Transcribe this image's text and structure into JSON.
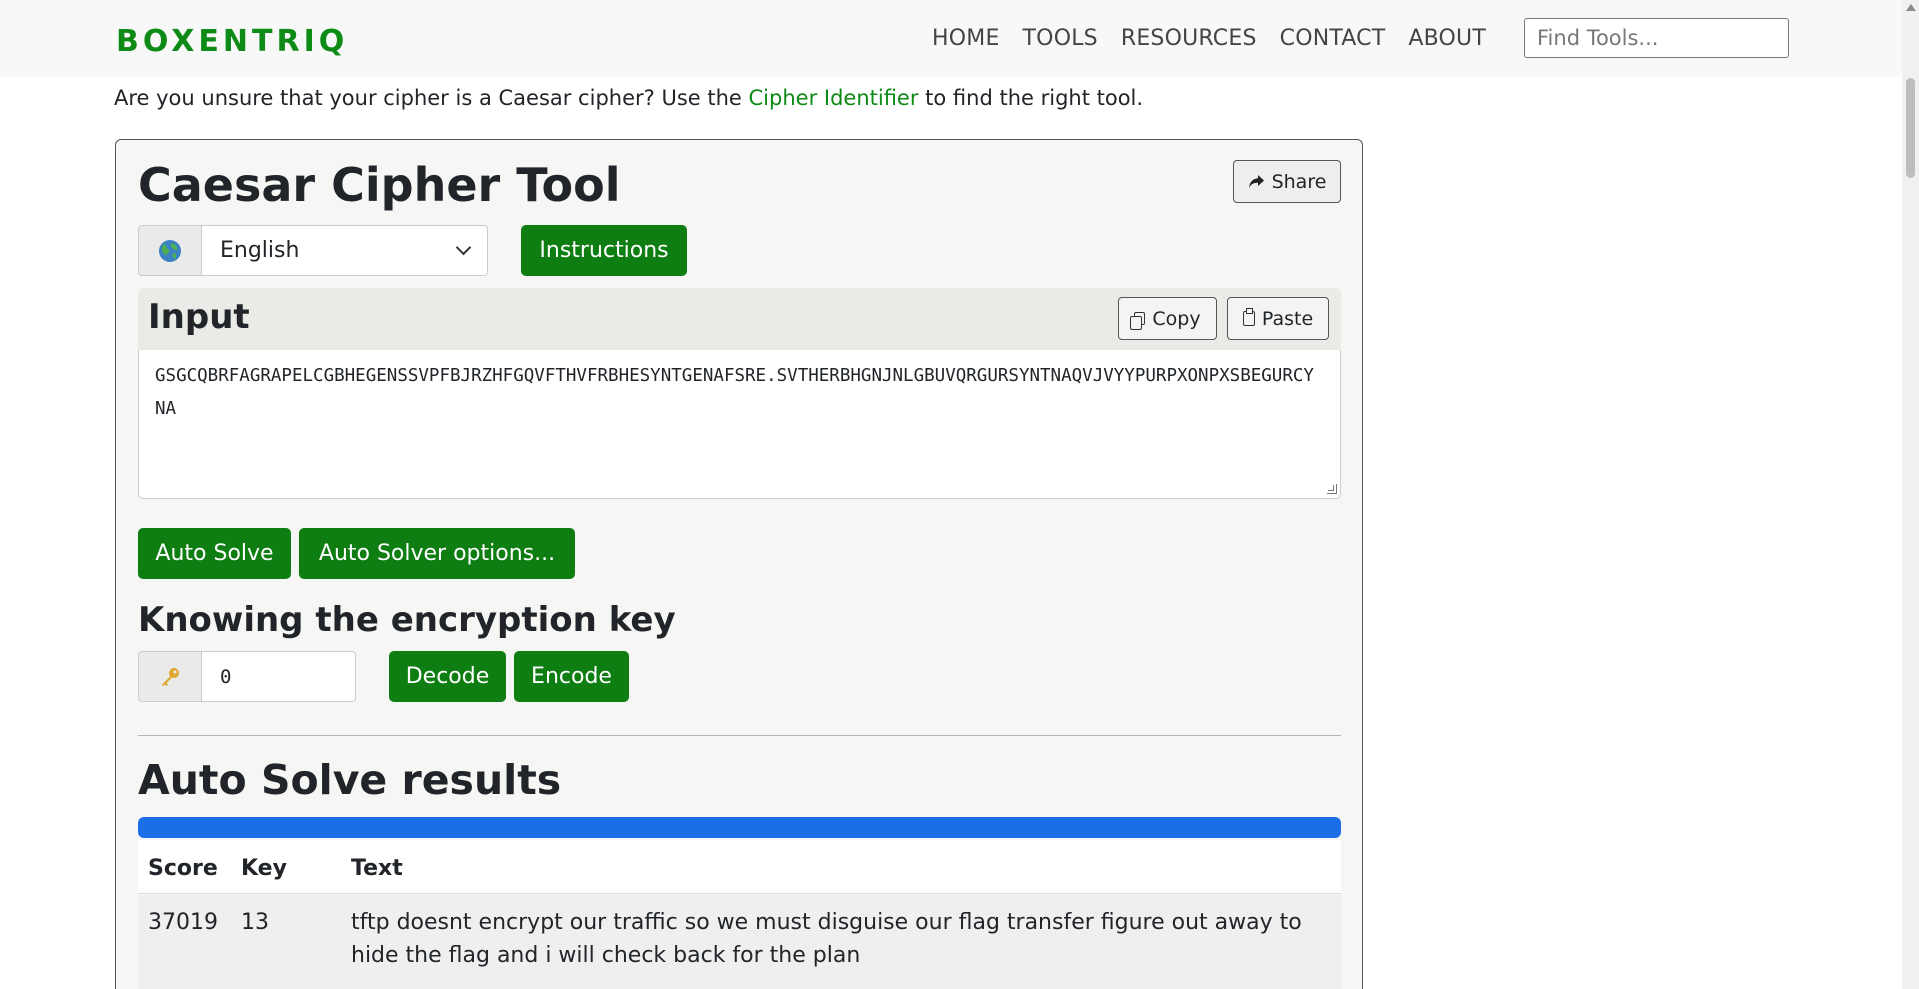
{
  "header": {
    "brand": "BOXENTRIQ",
    "nav": [
      "HOME",
      "TOOLS",
      "RESOURCES",
      "CONTACT",
      "ABOUT"
    ],
    "search_placeholder": "Find Tools..."
  },
  "intro": {
    "prefix": "Are you unsure that your cipher is a Caesar cipher? Use the ",
    "link": "Cipher Identifier",
    "suffix": " to find the right tool."
  },
  "tool": {
    "title": "Caesar Cipher Tool",
    "share_label": "Share",
    "language": "English",
    "instructions_label": "Instructions",
    "input_label": "Input",
    "copy_label": "Copy",
    "paste_label": "Paste",
    "input_text": "GSGCQBRFAGRAPELCGBHEGENSSVPFBJRZHFGQVFTHVFRBHESYNTGENAFSRE.SVTHERBHGNJNLGBUVQRGURSYNTNAQVJVYYPURPXONPXSBEGURCYNA",
    "auto_solve_label": "Auto Solve",
    "auto_solver_options_label": "Auto Solver options...",
    "key_heading": "Knowing the encryption key",
    "key_value": "0",
    "decode_label": "Decode",
    "encode_label": "Encode",
    "results_heading": "Auto Solve results",
    "progress_fraction": 1.0
  },
  "results": {
    "columns": [
      "Score",
      "Key",
      "Text"
    ],
    "rows": [
      {
        "score": "37019",
        "key": "13",
        "text": "tftp doesnt encrypt our traffic so we must disguise our flag transfer figure out away to hide the flag and i will check back for the plan"
      }
    ]
  },
  "icons": {
    "globe": "globe-icon",
    "key": "key-icon",
    "share": "share-icon",
    "copy": "copy-icon",
    "paste": "paste-icon",
    "dropdown": "chevron-down-icon"
  },
  "colors": {
    "brand_green": "#0e8a16",
    "button_green": "#0e7e12",
    "progress_blue": "#1a6fe8"
  }
}
